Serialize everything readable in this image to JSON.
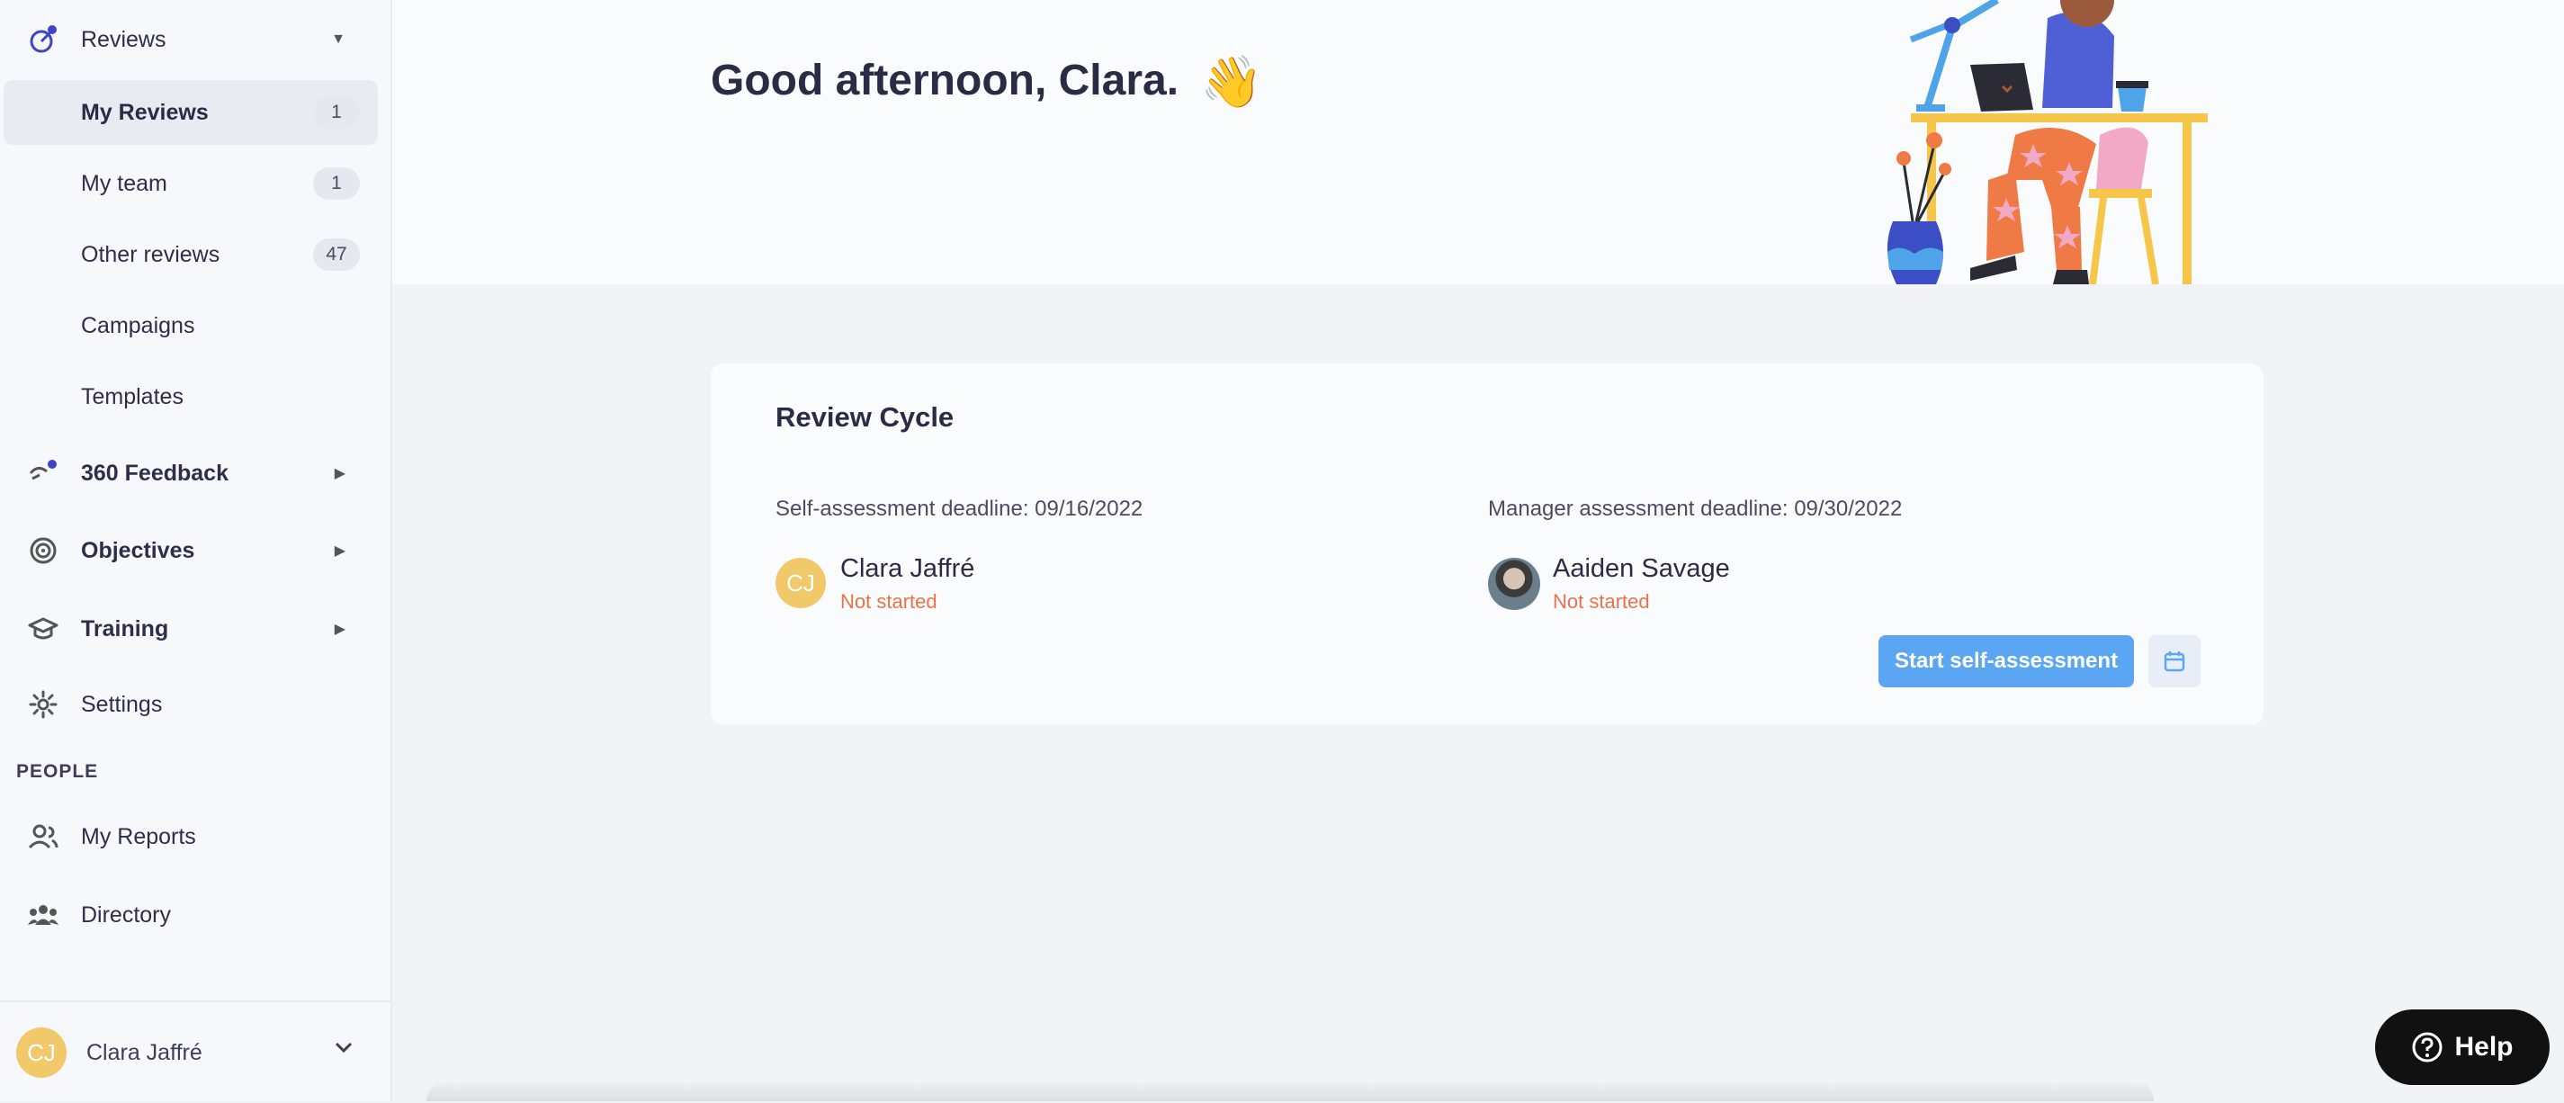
{
  "sidebar": {
    "reviews": {
      "label": "Reviews"
    },
    "sub_items": [
      {
        "label": "My Reviews",
        "count": "1"
      },
      {
        "label": "My team",
        "count": "1"
      },
      {
        "label": "Other reviews",
        "count": "47"
      },
      {
        "label": "Campaigns"
      },
      {
        "label": "Templates"
      }
    ],
    "feedback": {
      "label": "360 Feedback"
    },
    "objectives": {
      "label": "Objectives"
    },
    "training": {
      "label": "Training"
    },
    "settings": {
      "label": "Settings"
    },
    "people_section": "PEOPLE",
    "my_reports": {
      "label": "My Reports"
    },
    "directory": {
      "label": "Directory"
    },
    "user": {
      "initials": "CJ",
      "name": "Clara Jaffré"
    }
  },
  "header": {
    "greeting": "Good afternoon, Clara.",
    "wave_emoji": "👋"
  },
  "review_cycle": {
    "title": "Review Cycle",
    "self": {
      "deadline": "Self-assessment deadline: 09/16/2022",
      "initials": "CJ",
      "name": "Clara Jaffré",
      "status": "Not started"
    },
    "manager": {
      "deadline": "Manager assessment deadline: 09/30/2022",
      "name": "Aaiden Savage",
      "status": "Not started"
    },
    "start_button": "Start self-assessment"
  },
  "help": {
    "label": "Help"
  },
  "colors": {
    "accent_blue": "#5aa6f2",
    "status_orange": "#e8734a",
    "avatar_yellow": "#f2c96a",
    "nav_active_bg": "#e9ebf3"
  }
}
